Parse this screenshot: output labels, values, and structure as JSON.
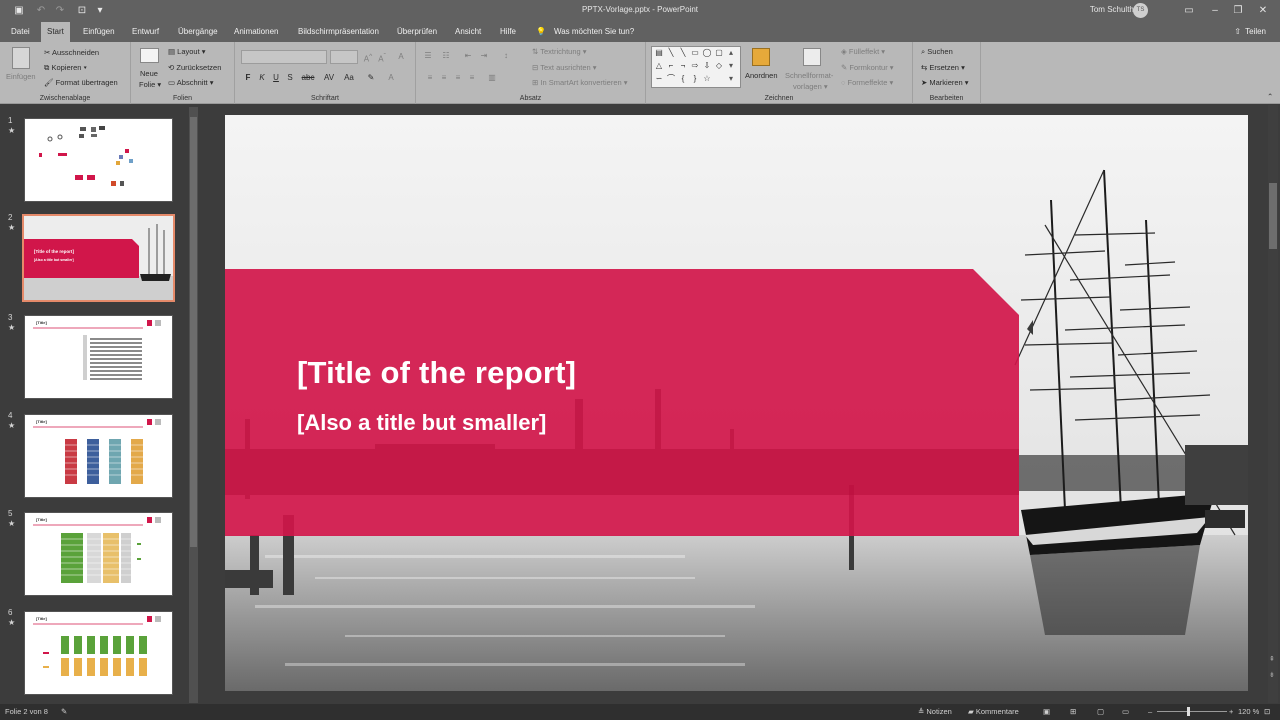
{
  "titlebar": {
    "document_title": "PPTX-Vorlage.pptx  -  PowerPoint",
    "user_name": "Tom Schultheiß",
    "user_initials": "TS"
  },
  "tabs": {
    "items": [
      "Datei",
      "Start",
      "Einfügen",
      "Entwurf",
      "Übergänge",
      "Animationen",
      "Bildschirmpräsentation",
      "Überprüfen",
      "Ansicht",
      "Hilfe"
    ],
    "active": "Start",
    "tell_me": "Was möchten Sie tun?",
    "share": "Teilen"
  },
  "ribbon": {
    "clipboard": {
      "label": "Zwischenablage",
      "paste": "Einfügen",
      "cut": "Ausschneiden",
      "copy": "Kopieren",
      "format_painter": "Format übertragen"
    },
    "slides": {
      "label": "Folien",
      "new_slide_line1": "Neue",
      "new_slide_line2": "Folie",
      "layout": "Layout",
      "reset": "Zurücksetzen",
      "section": "Abschnitt"
    },
    "font": {
      "label": "Schriftart",
      "bold": "F",
      "italic": "K",
      "underline": "U",
      "strike": "S",
      "shadow": "abc"
    },
    "paragraph": {
      "label": "Absatz",
      "text_direction": "Textrichtung",
      "align_text": "Text ausrichten",
      "smartart": "In SmartArt konvertieren"
    },
    "drawing": {
      "label": "Zeichnen",
      "arrange": "Anordnen",
      "quick_styles_line1": "Schnellformat-",
      "quick_styles_line2": "vorlagen",
      "fill": "Fülleffekt",
      "outline": "Formkontur",
      "effects": "Formeffekte"
    },
    "editing": {
      "label": "Bearbeiten",
      "find": "Suchen",
      "replace": "Ersetzen",
      "select": "Markieren"
    }
  },
  "thumbnails": [
    {
      "number": "1",
      "star": "★"
    },
    {
      "number": "2",
      "star": "★",
      "title": "[Title of the report]",
      "subtitle": "[Also a title but smaller]"
    },
    {
      "number": "3",
      "star": "★",
      "title": "[Title]"
    },
    {
      "number": "4",
      "star": "★",
      "title": "[Title]"
    },
    {
      "number": "5",
      "star": "★",
      "title": "[Title]"
    },
    {
      "number": "6",
      "star": "★",
      "title": "[Title]"
    }
  ],
  "slide": {
    "title": "[Title of the report]",
    "subtitle": "[Also a title but smaller]"
  },
  "statusbar": {
    "slide_info": "Folie 2 von 8",
    "notes": "Notizen",
    "comments": "Kommentare",
    "zoom": "120 %"
  },
  "colors": {
    "accent_red": "#d1164a",
    "chrome_dark": "#616161",
    "ribbon": "#b8b8b8",
    "pane": "#3c3c3c"
  }
}
